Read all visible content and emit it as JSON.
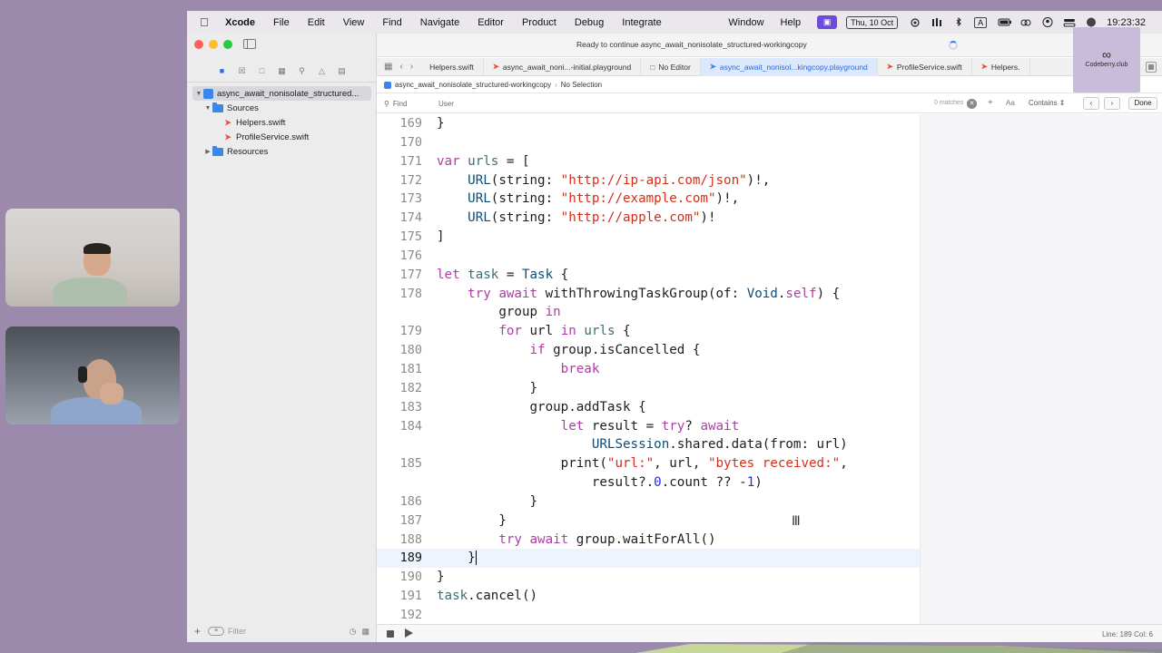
{
  "menubar": {
    "app_name": "Xcode",
    "items": [
      "File",
      "Edit",
      "View",
      "Find",
      "Navigate",
      "Editor",
      "Product",
      "Debug",
      "Integrate"
    ],
    "right_items": [
      "Window",
      "Help"
    ],
    "date": "Thu, 10 Oct",
    "time": "19:23:32"
  },
  "toolbar": {
    "status": "Ready to continue async_await_nonisolate_structured-workingcopy"
  },
  "tabs": [
    {
      "label": "Helpers.swift",
      "icon": "swift-icon"
    },
    {
      "label": "async_await_noni...-initial.playground",
      "icon": "swift-icon"
    },
    {
      "label": "No Editor",
      "icon": "doc-icon"
    },
    {
      "label": "async_await_nonisol...kingcopy.playground",
      "icon": "playground-icon"
    },
    {
      "label": "ProfileService.swift",
      "icon": "swift-icon"
    },
    {
      "label": "Helpers.",
      "icon": "swift-icon"
    }
  ],
  "navigator": {
    "project": "async_await_nonisolate_structured...",
    "items": [
      {
        "label": "Sources",
        "type": "folder"
      },
      {
        "label": "Helpers.swift",
        "type": "swift"
      },
      {
        "label": "ProfileService.swift",
        "type": "swift"
      },
      {
        "label": "Resources",
        "type": "folder"
      }
    ],
    "filter_placeholder": "Filter"
  },
  "jumpbar": {
    "file": "async_await_nonisolate_structured-workingcopy",
    "selection": "No Selection"
  },
  "findbar": {
    "mode": "Find",
    "query": "User",
    "matches": "0 matches",
    "aa": "Aa",
    "contains": "Contains",
    "done": "Done"
  },
  "code": {
    "current_line": 189,
    "lines": [
      {
        "n": "169",
        "text": "}"
      },
      {
        "n": "170",
        "text": ""
      },
      {
        "n": "171",
        "text": "var urls = ["
      },
      {
        "n": "172",
        "text": "    URL(string: \"http://ip-api.com/json\")!,"
      },
      {
        "n": "173",
        "text": "    URL(string: \"http://example.com\")!,"
      },
      {
        "n": "174",
        "text": "    URL(string: \"http://apple.com\")!"
      },
      {
        "n": "175",
        "text": "]"
      },
      {
        "n": "176",
        "text": ""
      },
      {
        "n": "177",
        "text": "let task = Task {"
      },
      {
        "n": "178",
        "text": "    try await withThrowingTaskGroup(of: Void.self) {"
      },
      {
        "n": "",
        "text": "        group in"
      },
      {
        "n": "179",
        "text": "        for url in urls {"
      },
      {
        "n": "180",
        "text": "            if group.isCancelled {"
      },
      {
        "n": "181",
        "text": "                break"
      },
      {
        "n": "182",
        "text": "            }"
      },
      {
        "n": "183",
        "text": "            group.addTask {"
      },
      {
        "n": "184",
        "text": "                let result = try? await"
      },
      {
        "n": "",
        "text": "                    URLSession.shared.data(from: url)"
      },
      {
        "n": "185",
        "text": "                print(\"url:\", url, \"bytes received:\","
      },
      {
        "n": "",
        "text": "                    result?.0.count ?? -1)"
      },
      {
        "n": "186",
        "text": "            }"
      },
      {
        "n": "187",
        "text": "        }"
      },
      {
        "n": "188",
        "text": "        try await group.waitForAll()"
      },
      {
        "n": "189",
        "text": "    }"
      },
      {
        "n": "190",
        "text": "}"
      },
      {
        "n": "191",
        "text": "task.cancel()"
      },
      {
        "n": "192",
        "text": ""
      }
    ]
  },
  "statusbar": {
    "position": "Line: 189  Col: 6"
  },
  "overlay": {
    "logo_text": "Codeberry.club"
  },
  "colors": {
    "keyword": "#ad3da4",
    "string": "#d12f1b",
    "type": "#0b4f79",
    "variable": "#3e6d74",
    "number": "#272ad8",
    "accent": "#2b6ad6"
  }
}
